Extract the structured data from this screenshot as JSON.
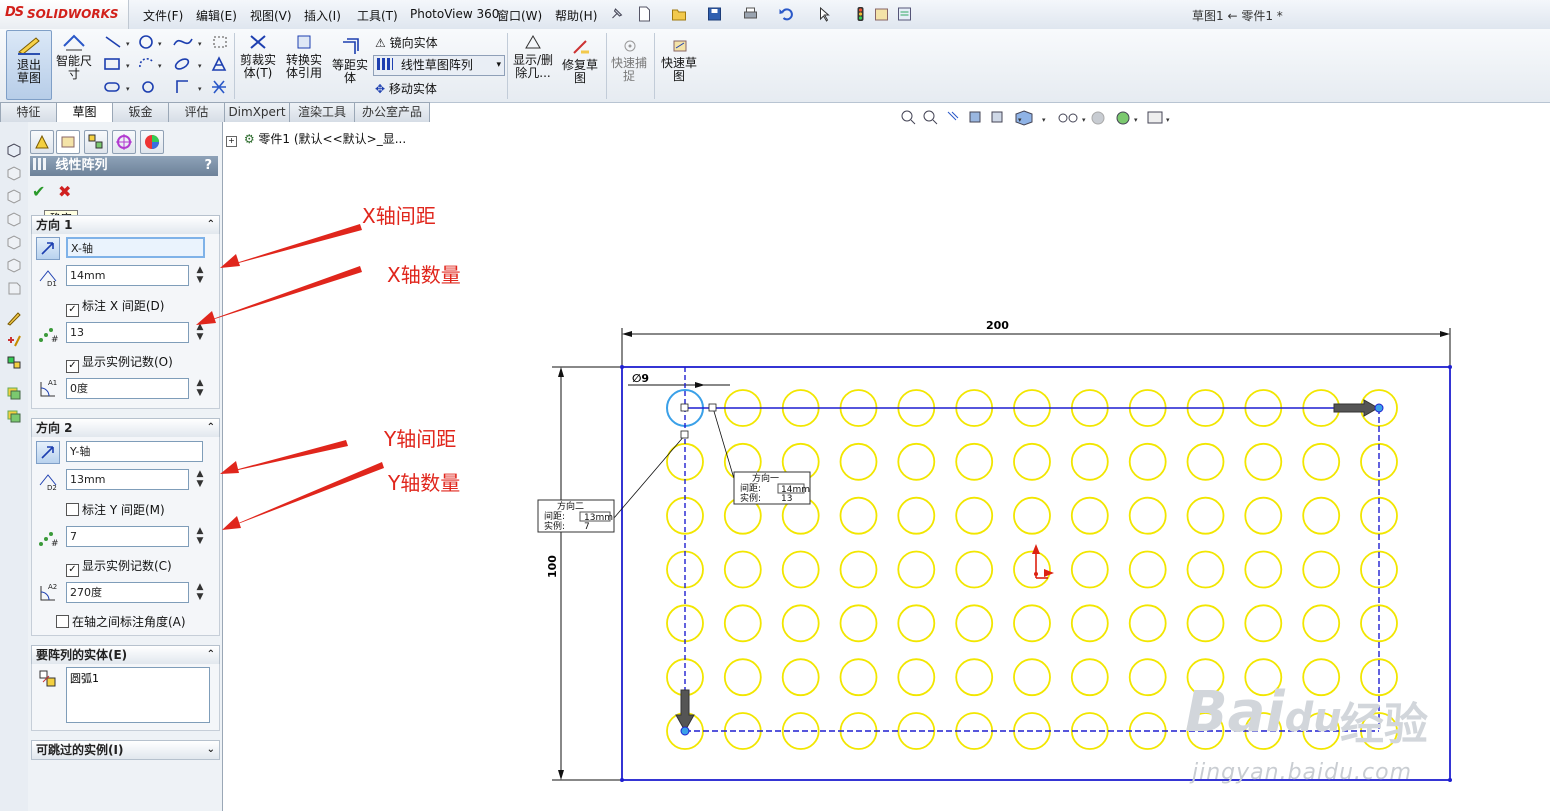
{
  "app": {
    "brand_prefix": "DS",
    "brand": "SOLIDWORKS",
    "title": "草图1 ← 零件1 *"
  },
  "menu": [
    "文件(F)",
    "编辑(E)",
    "视图(V)",
    "插入(I)",
    "工具(T)",
    "PhotoView 360",
    "窗口(W)",
    "帮助(H)"
  ],
  "ribbon": {
    "exit_sketch": "退出草图",
    "smart_dim": "智能尺寸",
    "trim": "剪裁实体(T)",
    "convert": "转换实体引用",
    "offset": "等距实体",
    "mirror": "镜向实体",
    "linear_pattern": "线性草图阵列",
    "move": "移动实体",
    "display_delete": "显示/删除几...",
    "repair": "修复草图",
    "quick_snap": "快速捕捉",
    "rapid_sketch": "快速草图"
  },
  "tabs": [
    {
      "label": "特征",
      "active": false
    },
    {
      "label": "草图",
      "active": true
    },
    {
      "label": "钣金",
      "active": false
    },
    {
      "label": "评估",
      "active": false
    },
    {
      "label": "DimXpert",
      "active": false
    },
    {
      "label": "渲染工具",
      "active": false
    },
    {
      "label": "办公室产品",
      "active": false
    }
  ],
  "tree": {
    "item": "零件1  (默认<<默认>_显..."
  },
  "pm": {
    "title": "线性阵列",
    "help": "?",
    "tooltip": "确定",
    "dir1": {
      "head": "方向 1",
      "axis": "X-轴",
      "spacing": "14mm",
      "dim_spacing_label": "标注 X 间距(D)",
      "dim_spacing_checked": true,
      "count": "13",
      "show_count_label": "显示实例记数(O)",
      "show_count_checked": true,
      "angle": "0度"
    },
    "dir2": {
      "head": "方向 2",
      "axis": "Y-轴",
      "spacing": "13mm",
      "dim_spacing_label": "标注 Y 间距(M)",
      "dim_spacing_checked": false,
      "count": "7",
      "show_count_label": "显示实例记数(C)",
      "show_count_checked": true,
      "angle": "270度",
      "axis_angle_label": "在轴之间标注角度(A)",
      "axis_angle_checked": false
    },
    "entities": {
      "head": "要阵列的实体(E)",
      "item": "圆弧1"
    },
    "skip": {
      "head": "可跳过的实例(I)"
    }
  },
  "annotations": [
    "X轴间距",
    "X轴数量",
    "Y轴间距",
    "Y轴数量"
  ],
  "sketch": {
    "width_dim": "200",
    "height_dim": "100",
    "diameter_dim": "∅9",
    "cols": 13,
    "rows": 7,
    "callout1": {
      "title": "方向一",
      "spacing_label": "间距:",
      "spacing": "14mm",
      "count_label": "实例:",
      "count": "13"
    },
    "callout2": {
      "title": "方向二",
      "spacing_label": "间距:",
      "spacing": "13mm",
      "count_label": "实例:",
      "count": "7"
    },
    "colors": {
      "outline": "#1f1fd0",
      "circle": "#f2e600",
      "selected": "#3aa0e8"
    }
  },
  "watermark": {
    "logo": "Bai",
    "logo2": "du",
    "cn": "经验",
    "url": "jingyan.baidu.com"
  }
}
